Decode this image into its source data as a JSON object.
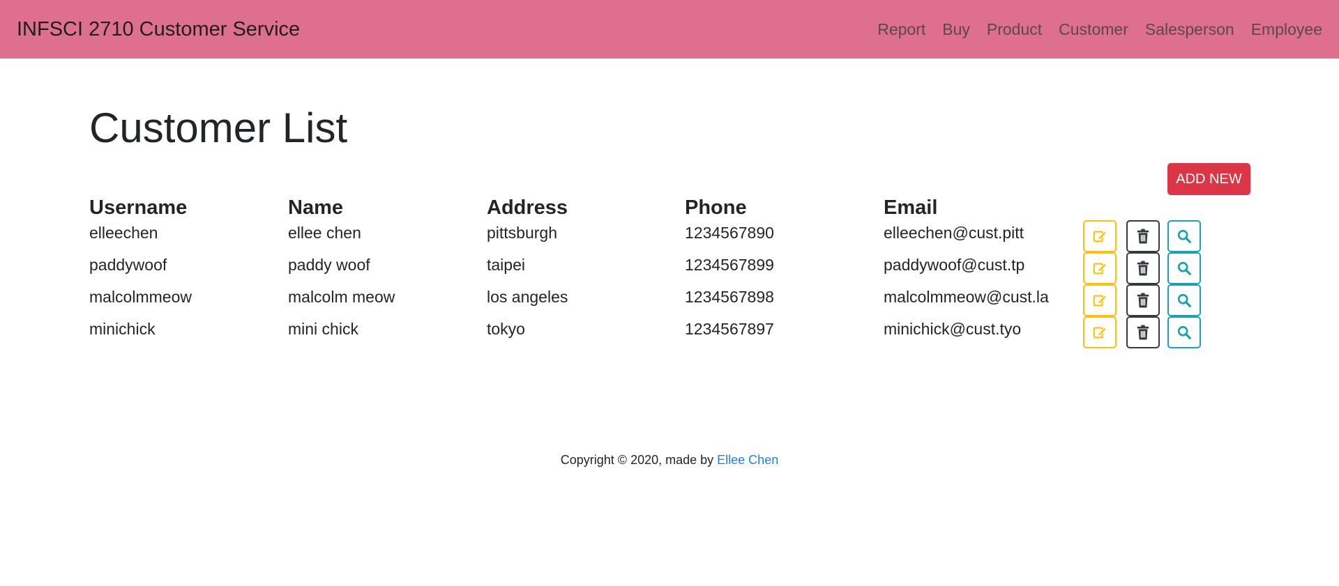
{
  "navbar": {
    "brand": "INFSCI 2710 Customer Service",
    "links": [
      "Report",
      "Buy",
      "Product",
      "Customer",
      "Salesperson",
      "Employee"
    ],
    "background": "#de6f8e"
  },
  "page": {
    "title": "Customer List",
    "add_label": "ADD NEW"
  },
  "table": {
    "headers": [
      "Username",
      "Name",
      "Address",
      "Phone",
      "Email"
    ],
    "rows": [
      [
        "elleechen",
        "ellee chen",
        "pittsburgh",
        "1234567890",
        "elleechen@cust.pitt"
      ],
      [
        "paddywoof",
        "paddy woof",
        "taipei",
        "1234567899",
        "paddywoof@cust.tp"
      ],
      [
        "malcolmmeow",
        "malcolm meow",
        "los angeles",
        "1234567898",
        "malcolmmeow@cust.la"
      ],
      [
        "minichick",
        "mini chick",
        "tokyo",
        "1234567897",
        "minichick@cust.tyo"
      ]
    ],
    "action_icons": [
      "edit-icon",
      "trash-icon",
      "search-icon"
    ]
  },
  "footer": {
    "text": "Copyright © 2020, made by ",
    "author": "Ellee Chen"
  },
  "colors": {
    "danger": "#dc3545",
    "warning": "#ffc107",
    "dark": "#343a40",
    "info": "#17a2b8",
    "link": "#2a7ee0"
  }
}
